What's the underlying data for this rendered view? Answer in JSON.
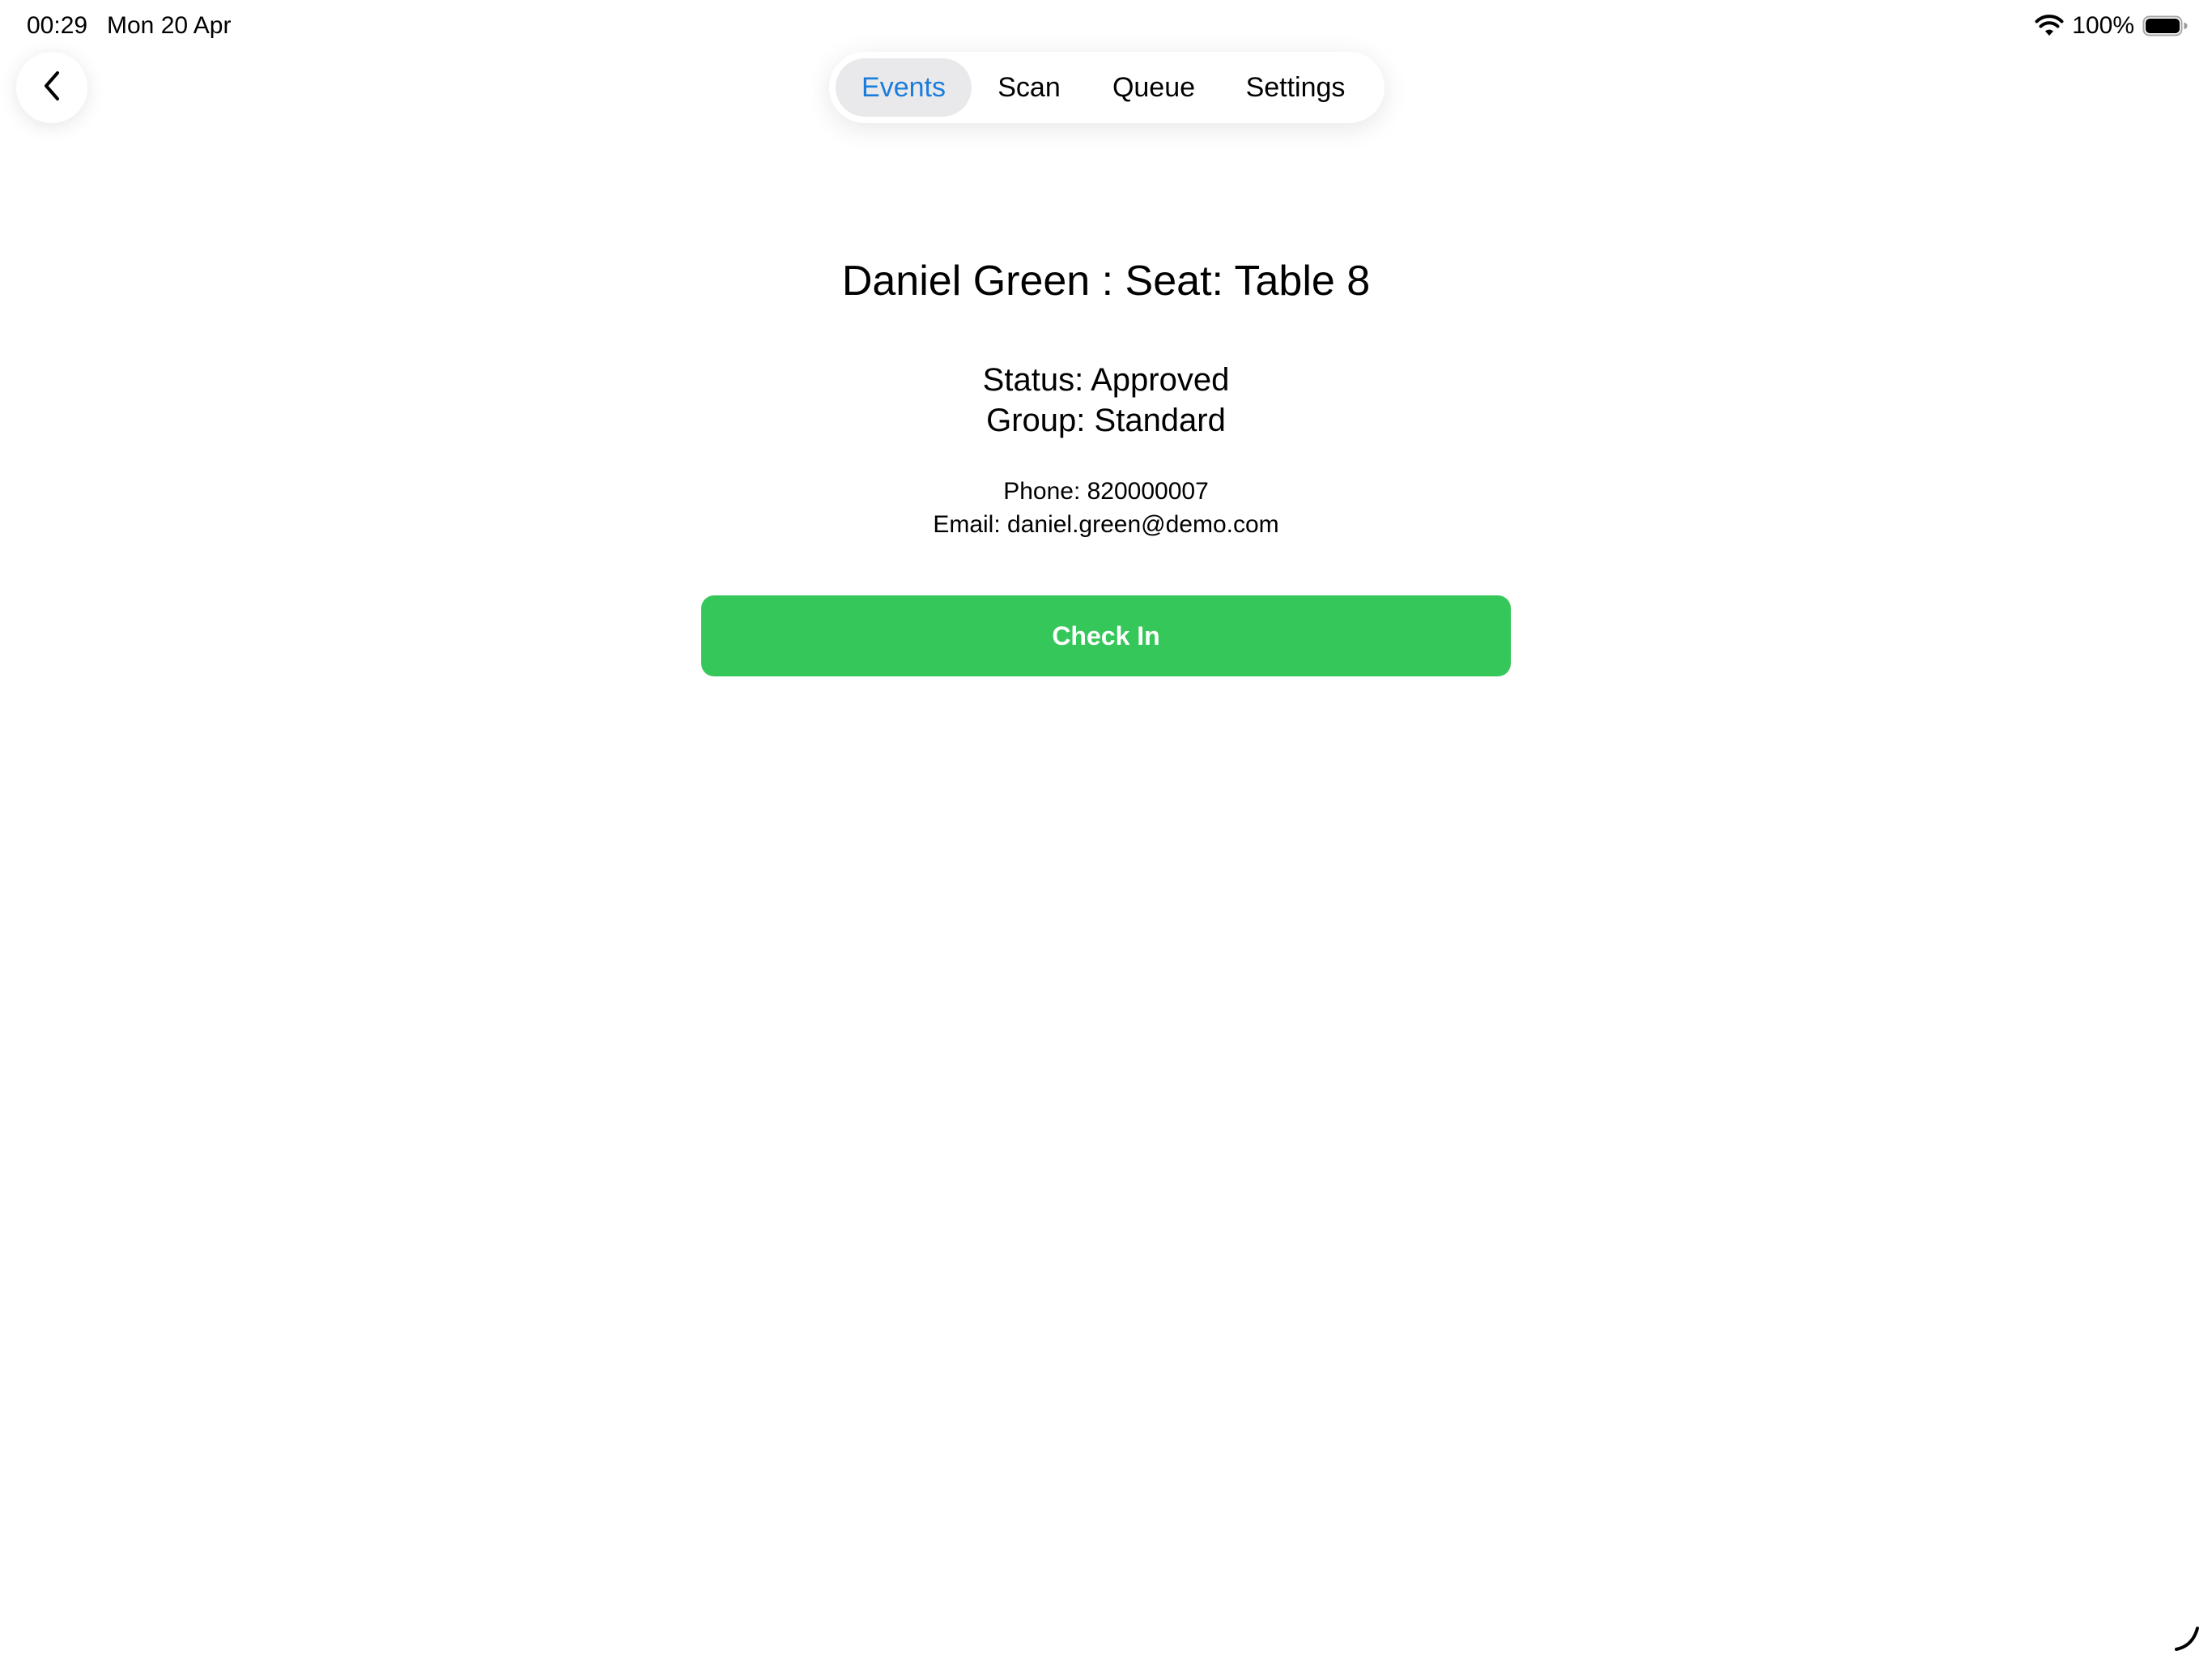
{
  "status_bar": {
    "time": "00:29",
    "date": "Mon 20 Apr",
    "battery_percent": "100%",
    "icons": [
      "wifi-icon",
      "battery-icon"
    ]
  },
  "navigation": {
    "back_icon": "chevron-left-icon",
    "tabs": [
      {
        "label": "Events",
        "active": true
      },
      {
        "label": "Scan",
        "active": false
      },
      {
        "label": "Queue",
        "active": false
      },
      {
        "label": "Settings",
        "active": false
      }
    ]
  },
  "guest": {
    "title": "Daniel Green : Seat: Table 8",
    "status_line": "Status: Approved",
    "group_line": "Group: Standard",
    "phone_line": "Phone: 820000007",
    "email_line": "Email: daniel.green@demo.com"
  },
  "actions": {
    "check_in_label": "Check In"
  },
  "colors": {
    "accent": "#1a7ddb",
    "check_in_button": "#35c759",
    "active_tab_background": "#e9e9eb",
    "background": "#ffffff"
  }
}
